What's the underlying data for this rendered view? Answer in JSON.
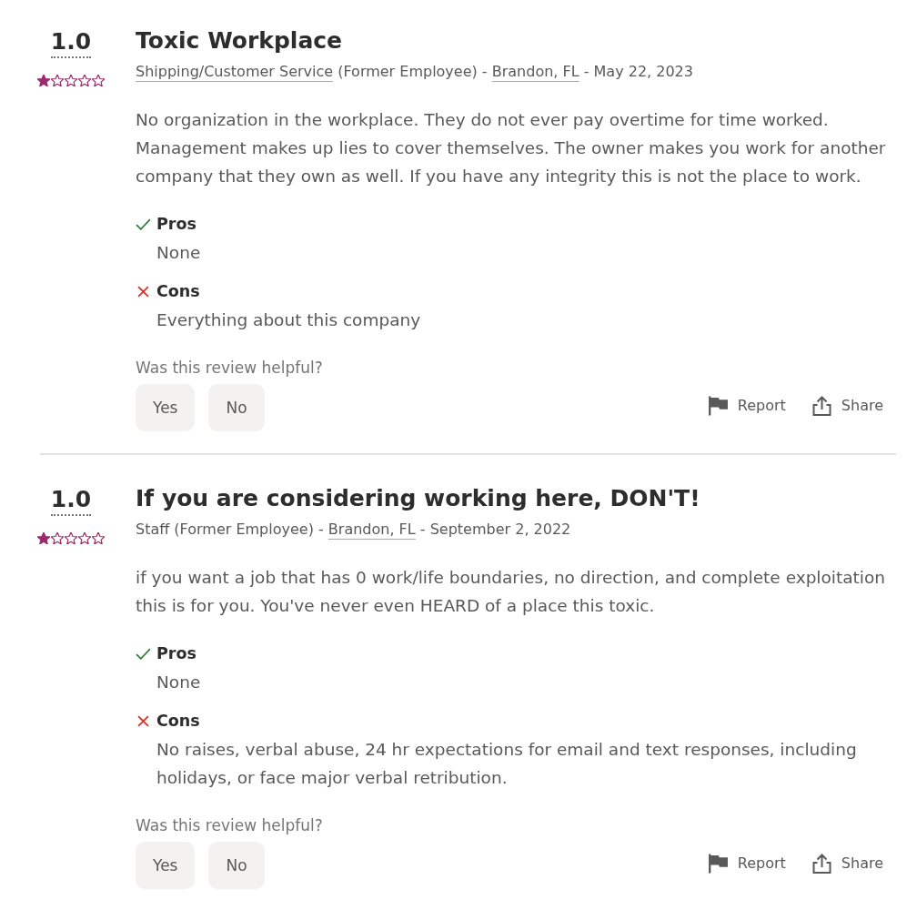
{
  "reviews": [
    {
      "rating": "1.0",
      "stars": 1,
      "title": "Toxic Workplace",
      "meta": [
        {
          "kind": "link",
          "text": "Shipping/Customer Service"
        },
        {
          "kind": "text",
          "text": "(Former Employee) -"
        },
        {
          "kind": "link",
          "text": "Brandon, FL"
        },
        {
          "kind": "text",
          "text": "- May 22, 2023"
        }
      ],
      "text": "No organization in the workplace. They do not ever pay overtime for time worked. Management makes up lies to cover themselves. The owner makes you work for another company that they own as well. If you have any integrity this is not the place to work.",
      "pros": {
        "label": "Pros",
        "text": "None"
      },
      "cons": {
        "label": "Cons",
        "text": "Everything about this company"
      },
      "helpful_question": "Was this review helpful?",
      "buttons": [
        "Yes",
        "No"
      ],
      "report": "Report",
      "share": "Share"
    },
    {
      "rating": "1.0",
      "stars": 1,
      "title": "If you are considering working here, DON'T!",
      "meta": [
        {
          "kind": "text",
          "text": "Staff (Former Employee) -"
        },
        {
          "kind": "link",
          "text": "Brandon, FL"
        },
        {
          "kind": "text",
          "text": "- September 2, 2022"
        }
      ],
      "text": "if you want a job that has 0 work/life boundaries, no direction, and complete exploitation this is for you. You've never even HEARD of a place this toxic.",
      "pros": {
        "label": "Pros",
        "text": "None"
      },
      "cons": {
        "label": "Cons",
        "text": "No raises, verbal abuse, 24 hr expectations for email and text responses, including holidays, or face major verbal retribution."
      },
      "helpful_question": "Was this review helpful?",
      "buttons": [
        "Yes",
        "No"
      ],
      "report": "Report",
      "share": "Share"
    }
  ]
}
